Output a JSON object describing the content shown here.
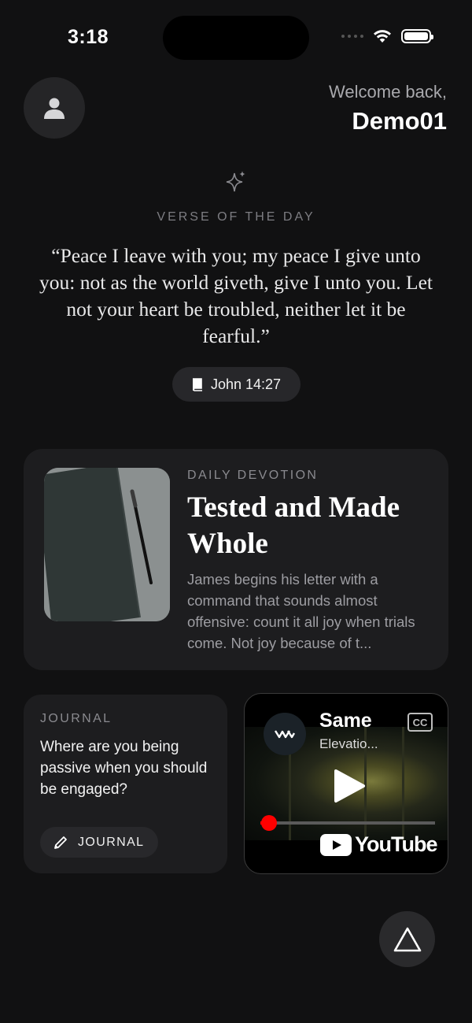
{
  "status_bar": {
    "time": "3:18"
  },
  "header": {
    "avatar_icon": "person-icon",
    "welcome_label": "Welcome back,",
    "user_name": "Demo01"
  },
  "verse_of_the_day": {
    "sparkle_icon": "sparkle-icon",
    "label": "VERSE OF THE DAY",
    "text": "“Peace I leave with you; my peace I give unto you: not as the world giveth, give I unto you. Let not your heart be troubled, neither let it be fearful.”",
    "reference_icon": "book-icon",
    "reference": "John 14:27"
  },
  "daily_devotion": {
    "label": "DAILY DEVOTION",
    "title": "Tested and Made Whole",
    "summary": "James begins his letter with a command that sounds almost offensive: count it all joy when trials come. Not joy because of t..."
  },
  "journal": {
    "label": "JOURNAL",
    "prompt": "Where are you being passive when you should be engaged?",
    "button_icon": "pencil-icon",
    "button_label": "JOURNAL"
  },
  "video": {
    "title": "Same",
    "channel": "Elevatio...",
    "cc_label": "CC",
    "brand": "YouTube",
    "progress": 0.05
  },
  "fab": {
    "icon": "triangle-icon"
  }
}
